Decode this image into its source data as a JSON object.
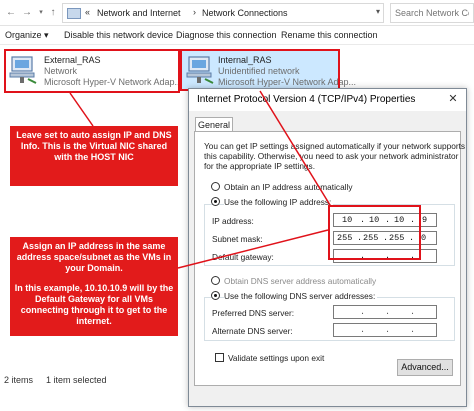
{
  "window": {
    "breadcrumbs": [
      "Network and Internet",
      "Network Connections"
    ],
    "search_placeholder": "Search Network Conn"
  },
  "toolbar": {
    "organize": "Organize",
    "disable": "Disable this network device",
    "diagnose": "Diagnose this connection",
    "rename": "Rename this connection"
  },
  "items": [
    {
      "name": "External_RAS",
      "status": "Network",
      "adapter": "Microsoft Hyper-V Network Adap..."
    },
    {
      "name": "Internal_RAS",
      "status": "Unidentified network",
      "adapter": "Microsoft Hyper-V Network Adap..."
    }
  ],
  "status_bar": {
    "count": "2 items",
    "selected": "1 item selected"
  },
  "dialog": {
    "title": "Internet Protocol Version 4 (TCP/IPv4) Properties",
    "tab": "General",
    "intro": [
      "You can get IP settings assigned automatically if your network supports",
      "this capability. Otherwise, you need to ask your network administrator",
      "for the appropriate IP settings."
    ],
    "obtain_ip_auto": "Obtain an IP address automatically",
    "use_following_ip": "Use the following IP address:",
    "ip_label": "IP address:",
    "ip_value": [
      "10",
      "10",
      "10",
      "9"
    ],
    "subnet_label": "Subnet mask:",
    "subnet_value": [
      "255",
      "255",
      "255",
      "0"
    ],
    "gateway_label": "Default gateway:",
    "obtain_dns_auto": "Obtain DNS server address automatically",
    "use_following_dns": "Use the following DNS server addresses:",
    "preferred_dns_label": "Preferred DNS server:",
    "alternate_dns_label": "Alternate DNS server:",
    "validate": "Validate settings upon exit",
    "advanced_button": "Advanced..."
  },
  "annotations": {
    "note1": "Leave set to auto assign IP and DNS Info. This is the Virtual NIC shared with the HOST NIC",
    "note2_a": "Assign an IP address in the same address space/subnet as the VMs in your Domain.",
    "note2_b": "In this example, 10.10.10.9 will by the Default Gateway for all VMs connecting through it to get to the internet."
  },
  "colors": {
    "annotation_red": "#e21b1b",
    "highlight_border": "#e0121a"
  }
}
